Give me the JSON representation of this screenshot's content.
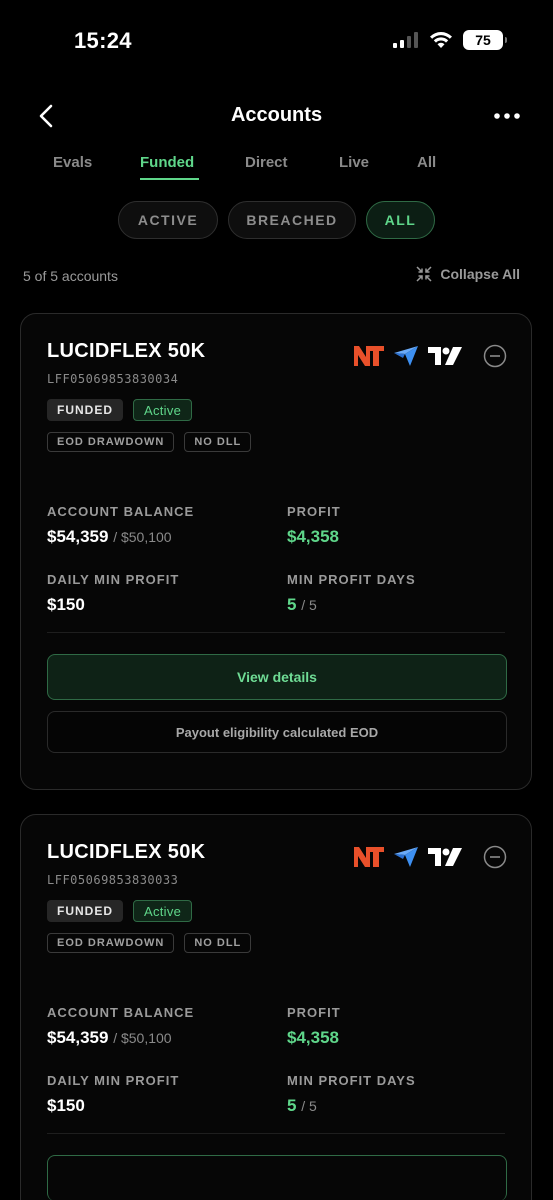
{
  "status_bar": {
    "time": "15:24",
    "battery": "75"
  },
  "header": {
    "title": "Accounts"
  },
  "tabs": [
    {
      "label": "Evals"
    },
    {
      "label": "Funded"
    },
    {
      "label": "Direct"
    },
    {
      "label": "Live"
    },
    {
      "label": "All"
    }
  ],
  "active_tab": "Funded",
  "filters": [
    {
      "label": "ACTIVE"
    },
    {
      "label": "BREACHED"
    },
    {
      "label": "ALL"
    }
  ],
  "active_filter": "ALL",
  "summary": {
    "count": "5 of 5 accounts",
    "collapse_label": "Collapse All"
  },
  "labels": {
    "account_balance": "ACCOUNT BALANCE",
    "profit": "PROFIT",
    "daily_min_profit": "DAILY MIN PROFIT",
    "min_profit_days": "MIN PROFIT DAYS",
    "view_details": "View details",
    "payout_note": "Payout eligibility calculated EOD"
  },
  "accounts": [
    {
      "name": "LUCIDFLEX 50K",
      "id": "LFF05069853830034",
      "type_badge": "FUNDED",
      "status_badge": "Active",
      "tags": [
        "EOD DRAWDOWN",
        "NO DLL"
      ],
      "balance": "$54,359",
      "balance_start": "/ $50,100",
      "profit": "$4,358",
      "daily_min_profit": "$150",
      "min_profit_days": "5",
      "min_profit_days_total": "/ 5"
    },
    {
      "name": "LUCIDFLEX 50K",
      "id": "LFF05069853830033",
      "type_badge": "FUNDED",
      "status_badge": "Active",
      "tags": [
        "EOD DRAWDOWN",
        "NO DLL"
      ],
      "balance": "$54,359",
      "balance_start": "/ $50,100",
      "profit": "$4,358",
      "daily_min_profit": "$150",
      "min_profit_days": "5",
      "min_profit_days_total": "/ 5"
    }
  ],
  "colors": {
    "accent": "#5fd68a",
    "ninjatrader": "#e8502a",
    "tradovate": "#3d8ff0",
    "tradingview": "#ffffff"
  },
  "icons": {
    "back": "chevron-left-icon",
    "more": "ellipsis-icon",
    "collapse": "collapse-arrows-icon",
    "card_collapse": "minus-circle-icon"
  }
}
